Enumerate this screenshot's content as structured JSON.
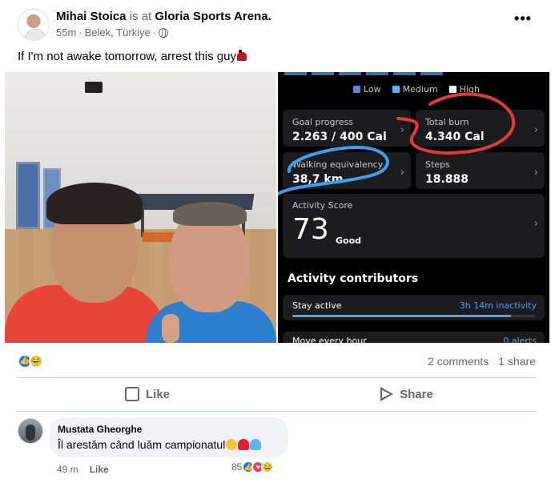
{
  "post": {
    "author": "Mihai Stoica",
    "is_at": "is at",
    "place": "Gloria Sports Arena.",
    "time": "55m",
    "location": "Belek, Türkiye",
    "separator": "·",
    "text": "If I'm not awake tomorrow, arrest this guy",
    "more_label": "•••"
  },
  "fitness": {
    "legend": [
      {
        "label": "Low",
        "color": "#4a8fd9"
      },
      {
        "label": "Medium",
        "color": "#5ab4ef"
      },
      {
        "label": "High",
        "color": "#ffffff"
      }
    ],
    "cards": [
      {
        "label": "Goal progress",
        "value": "2.263 / 400 Cal"
      },
      {
        "label": "Total burn",
        "value": "4.340 Cal"
      },
      {
        "label": "Walking equivalency",
        "value": "38,7 km"
      },
      {
        "label": "Steps",
        "value": "18.888"
      }
    ],
    "score_label": "Activity Score",
    "score_value": "73",
    "score_rating": "Good",
    "contributors_title": "Activity contributors",
    "stay_active": {
      "label": "Stay active",
      "value": "3h 14m inactivity",
      "progress": 0.9
    },
    "move_hour": {
      "label": "Move every hour",
      "value": "0 alerts"
    },
    "chevron": "›",
    "annotation_colors": {
      "red": "#e23a3a",
      "blue": "#3b9ff0"
    }
  },
  "stats": {
    "comments": "2 comments",
    "shares": "1 share"
  },
  "actions": {
    "like": "Like",
    "share": "Share"
  },
  "comment": {
    "author": "Mustata Gheorghe",
    "text": "Îl arestăm când luăm campionatul",
    "time": "49 m",
    "like": "Like",
    "reaction_count": "85"
  },
  "colors": {
    "like_blue": "#1877f2",
    "meta_gray": "#65676b"
  }
}
